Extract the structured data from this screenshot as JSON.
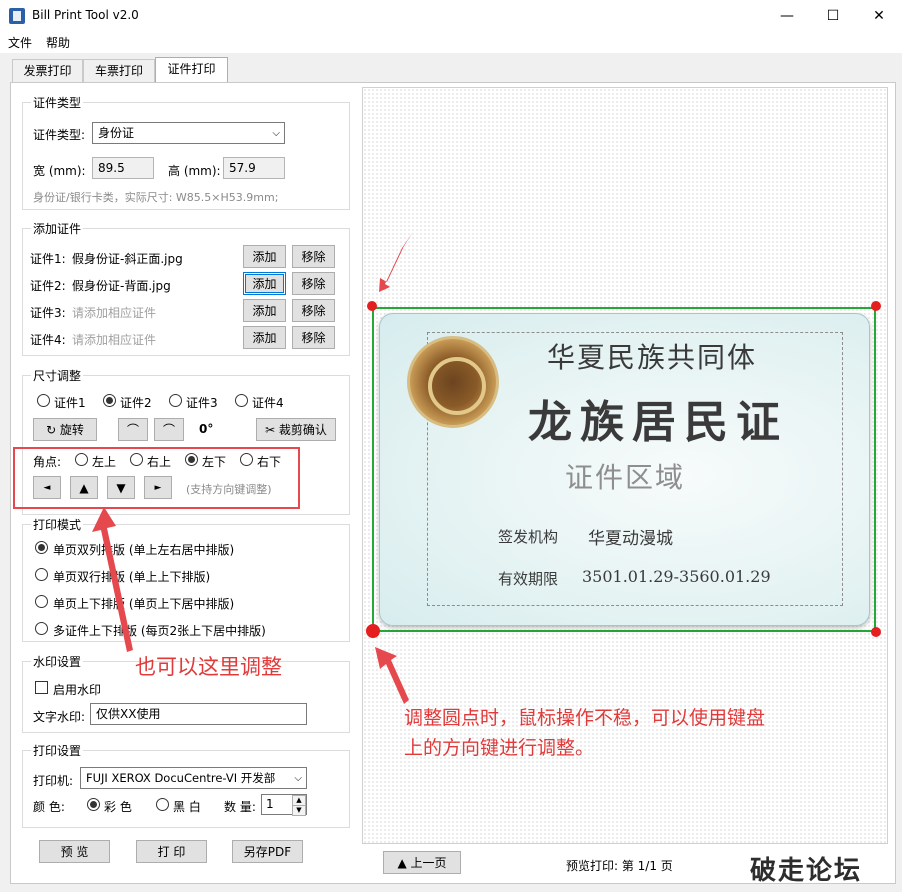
{
  "window": {
    "title": "Bill Print Tool v2.0",
    "minimize": "—",
    "maximize": "☐",
    "close": "✕"
  },
  "menu": {
    "file": "文件",
    "help": "帮助"
  },
  "tabs": {
    "invoice": "发票打印",
    "ticket": "车票打印",
    "certificate": "证件打印"
  },
  "cert_type": {
    "group_title": "证件类型",
    "type_label": "证件类型:",
    "type_value": "身份证",
    "width_label": "宽 (mm):",
    "width_value": "89.5",
    "height_label": "高 (mm):",
    "height_value": "57.9",
    "hint": "身份证/银行卡类，实际尺寸: W85.5×H53.9mm;"
  },
  "add_cert": {
    "group_title": "添加证件",
    "add_label": "添加",
    "remove_label": "移除",
    "items": [
      {
        "label": "证件1:",
        "file": "假身份证-斜正面.jpg"
      },
      {
        "label": "证件2:",
        "file": "假身份证-背面.jpg"
      },
      {
        "label": "证件3:",
        "file": "请添加相应证件"
      },
      {
        "label": "证件4:",
        "file": "请添加相应证件"
      }
    ]
  },
  "size_adjust": {
    "group_title": "尺寸调整",
    "cert_options": [
      "证件1",
      "证件2",
      "证件3",
      "证件4"
    ],
    "selected_cert": "证件2",
    "rotate_label": "↻ 旋转",
    "rotate_left": "⌒",
    "rotate_right": "⌒",
    "angle": "0°",
    "crop_label": "✂ 裁剪确认",
    "corner_label": "角点:",
    "corner_options": [
      "左上",
      "右上",
      "左下",
      "右下"
    ],
    "selected_corner": "左下",
    "arrow_left": "◄",
    "arrow_up": "▲",
    "arrow_down": "▼",
    "arrow_right": "►",
    "arrow_hint": "(支持方向键调整)"
  },
  "print_mode": {
    "group_title": "打印模式",
    "options": [
      "单页双列排版 (单上左右居中排版)",
      "单页双行排版 (单上上下排版)",
      "单页上下排版 (单页上下居中排版)",
      "多证件上下排版 (每页2张上下居中排版)"
    ],
    "selected_index": 0
  },
  "watermark": {
    "group_title": "水印设置",
    "enable_label": "启用水印",
    "enabled": false,
    "text_label": "文字水印:",
    "text_value": "仅供XX使用"
  },
  "print_settings": {
    "group_title": "打印设置",
    "printer_label": "打印机:",
    "printer_value": "FUJI XEROX DocuCentre-VI 开发部",
    "color_label": "颜 色:",
    "color_options": [
      "彩 色",
      "黑 白"
    ],
    "selected_color": "彩 色",
    "qty_label": "数 量:",
    "qty_value": "1"
  },
  "buttons": {
    "preview": "预 览",
    "print": "打 印",
    "save_pdf": "另存PDF"
  },
  "preview_area": {
    "prev_page": "▲ 上一页",
    "page_status": "预览打印: 第 1/1 页"
  },
  "card": {
    "title_small": "华夏民族共同体",
    "title_big": "龙族居民证",
    "area_text": "证件区域",
    "issuer_label": "签发机构",
    "issuer_value": "华夏动漫城",
    "valid_label": "有效期限",
    "valid_value": "3501.01.29-3560.01.29"
  },
  "annotations": {
    "left_note": "也可以这里调整",
    "right_note_line1": "调整圆点时，鼠标操作不稳，可以使用键盘",
    "right_note_line2": "上的方向键进行调整。"
  },
  "corner_logo": "破走论坛",
  "colors": {
    "annotation_red": "#e03a3a",
    "selection_green": "#25a836",
    "handle_red": "#e51f1f",
    "focus_blue": "#0078d7"
  }
}
